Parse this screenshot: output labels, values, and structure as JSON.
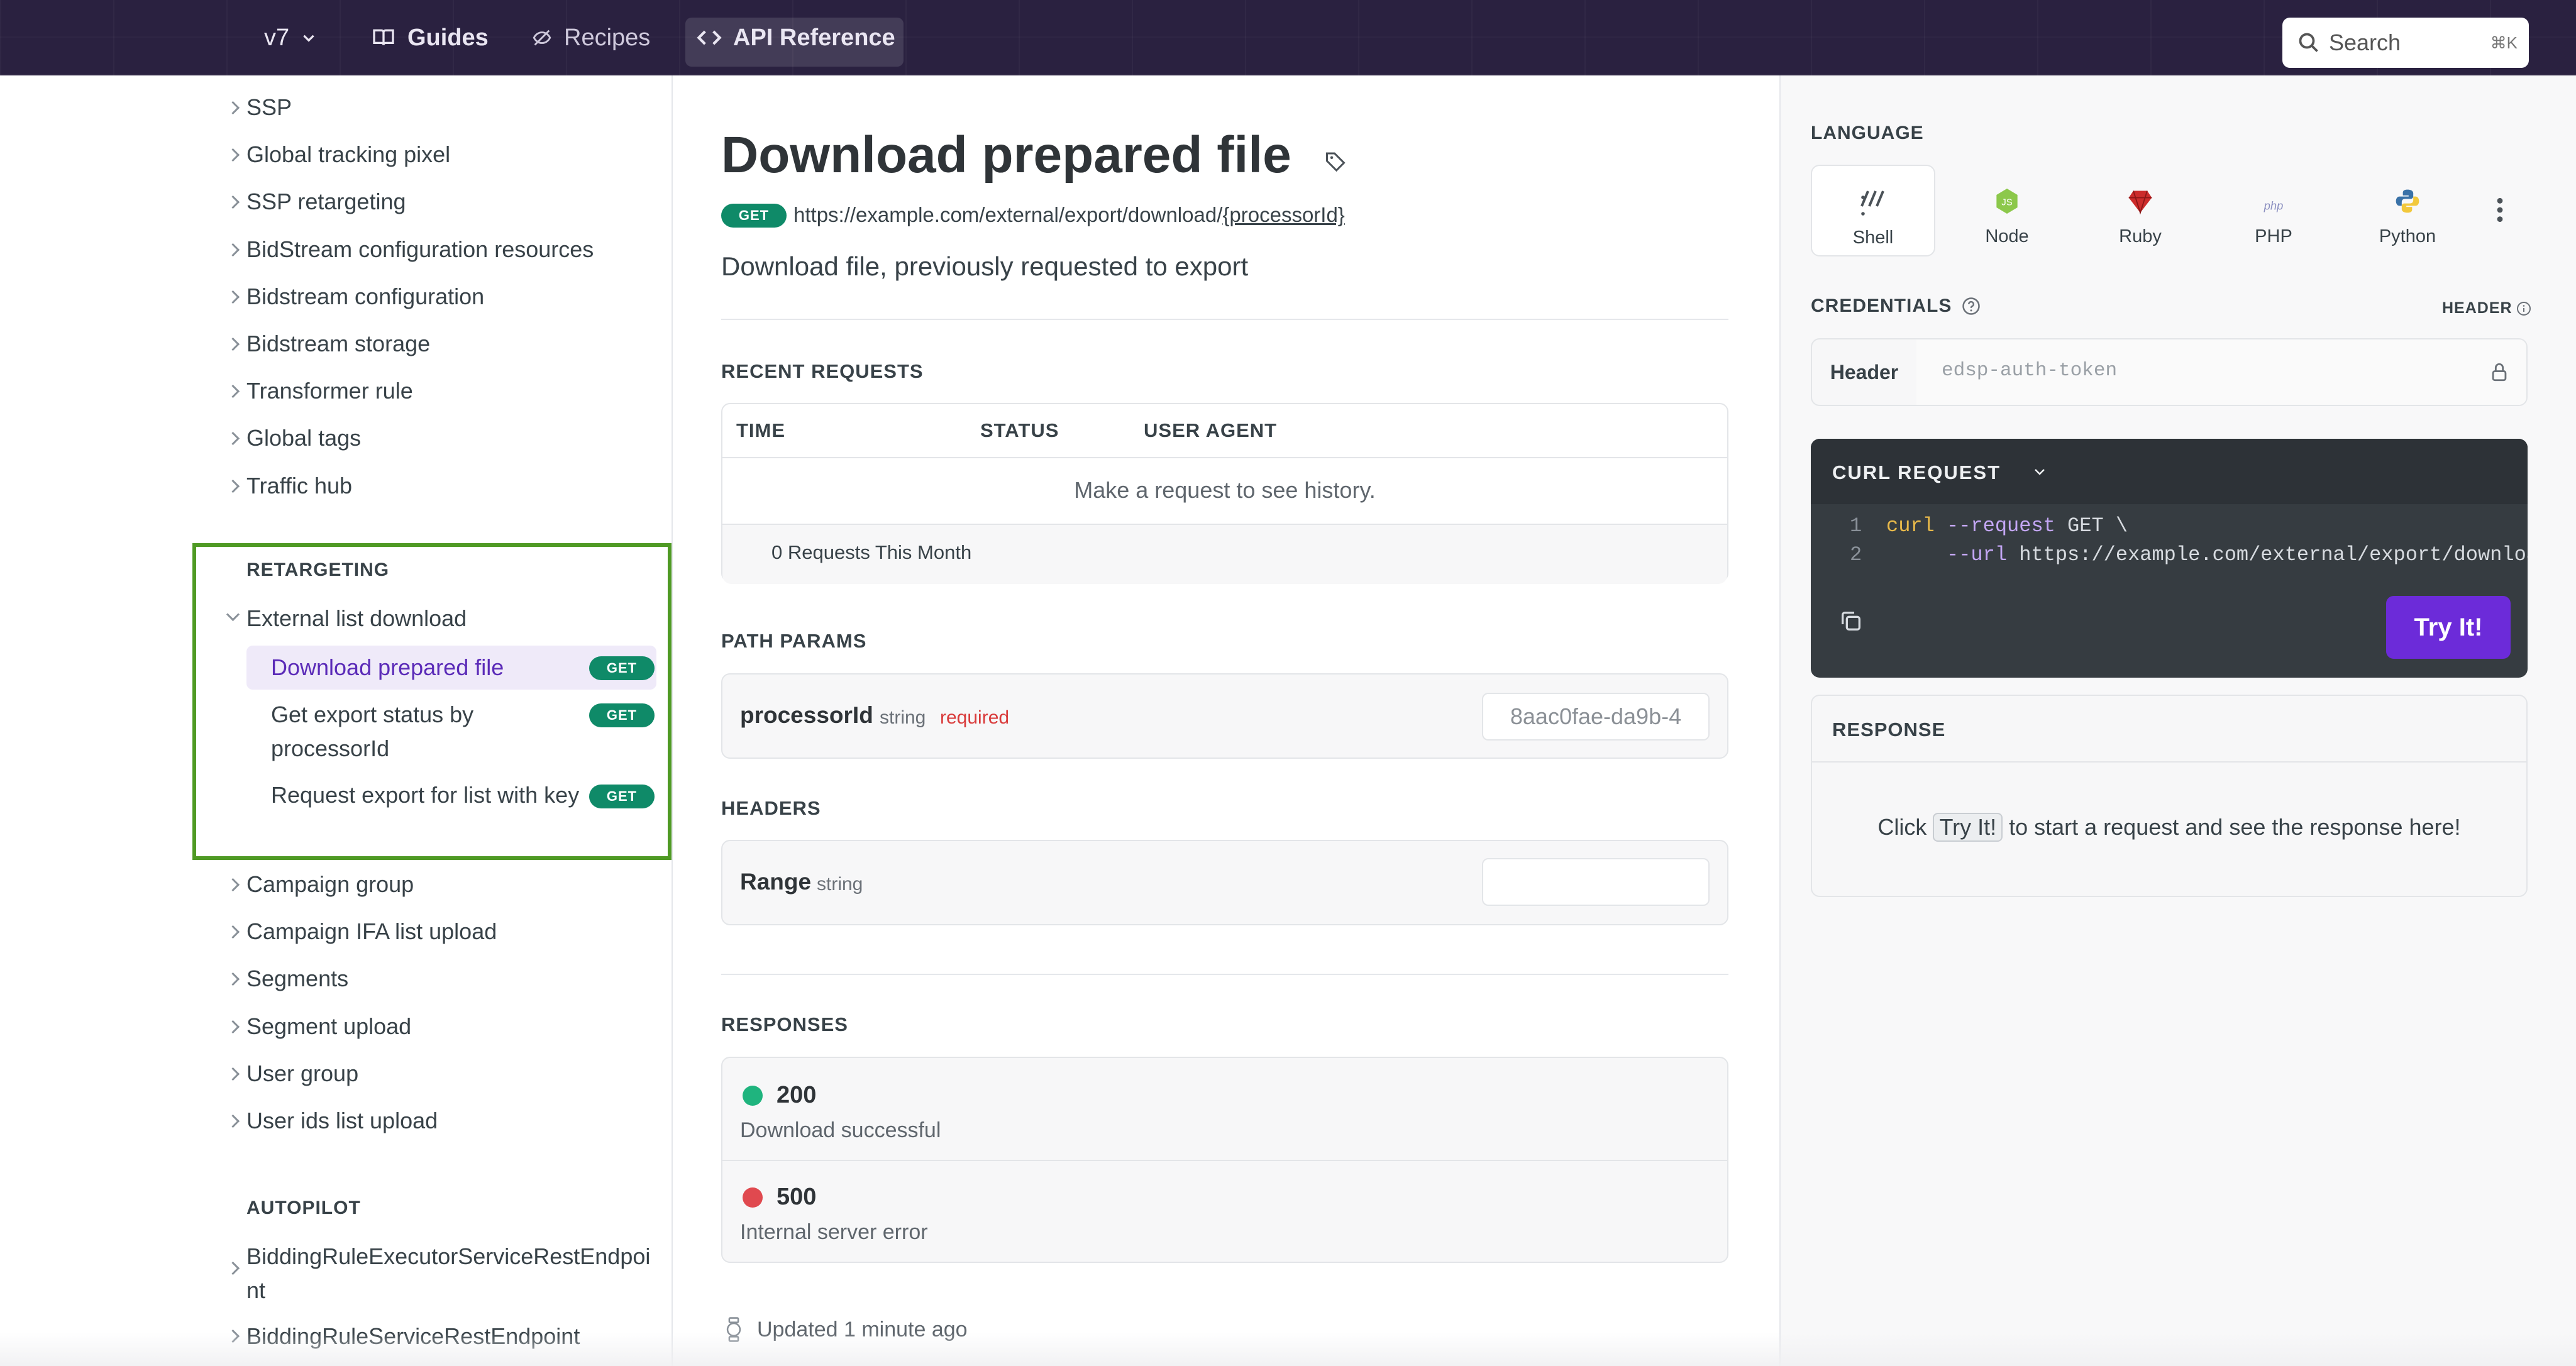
{
  "nav": {
    "version": "v7",
    "guides": "Guides",
    "recipes": "Recipes",
    "api_reference": "API Reference",
    "search_placeholder": "Search",
    "search_shortcut": "⌘K"
  },
  "sidebar": {
    "items_top": [
      "SSP",
      "Global tracking pixel",
      "SSP retargeting",
      "BidStream configuration resources",
      "Bidstream configuration",
      "Bidstream storage",
      "Transformer rule",
      "Global tags",
      "Traffic hub"
    ],
    "retargeting_title": "RETARGETING",
    "group_label": "External list download",
    "sub_items": [
      {
        "label": "Download prepared file",
        "method": "GET"
      },
      {
        "label": "Get export status by processorId",
        "method": "GET"
      },
      {
        "label": "Request export for list with key",
        "method": "GET"
      }
    ],
    "items_after": [
      "Campaign group",
      "Campaign IFA list upload",
      "Segments",
      "Segment upload",
      "User group",
      "User ids list upload"
    ],
    "autopilot_title": "AUTOPILOT",
    "autopilot_items": [
      "BiddingRuleExecutorServiceRestEndpoint",
      "BiddingRuleServiceRestEndpoint"
    ]
  },
  "main": {
    "title": "Download prepared file",
    "method": "GET",
    "url_prefix": "https://example.com/external/export/download/",
    "url_param": "{processorId}",
    "description": "Download file, previously requested to export",
    "recent_requests": {
      "title": "RECENT REQUESTS",
      "columns": [
        "TIME",
        "STATUS",
        "USER AGENT"
      ],
      "empty": "Make a request to see history.",
      "count": "0 Requests This Month"
    },
    "path_params": {
      "title": "PATH PARAMS",
      "name": "processorId",
      "type": "string",
      "required": "required",
      "value": "8aac0fae-da9b-4"
    },
    "headers": {
      "title": "HEADERS",
      "name": "Range",
      "type": "string"
    },
    "responses": {
      "title": "RESPONSES",
      "items": [
        {
          "code": "200",
          "desc": "Download successful",
          "color": "#1fb47e"
        },
        {
          "code": "500",
          "desc": "Internal server error",
          "color": "#e0494f"
        }
      ]
    },
    "updated": "Updated 1 minute ago"
  },
  "right": {
    "language_title": "LANGUAGE",
    "languages": [
      "Shell",
      "Node",
      "Ruby",
      "PHP",
      "Python"
    ],
    "credentials_title": "CREDENTIALS",
    "header_toggle": "HEADER",
    "header_label": "Header",
    "token_placeholder": "edsp-auth-token",
    "curl_title": "CURL REQUEST",
    "code_lines": [
      {
        "n": "1",
        "text": "curl --request GET \\"
      },
      {
        "n": "2",
        "text": "     --url https://example.com/external/export/downloa"
      }
    ],
    "try_it": "Try It!",
    "response_title": "RESPONSE",
    "response_pre": "Click",
    "response_chip": "Try It!",
    "response_post": "to start a request and see the response here!"
  },
  "colors": {
    "topbar": "#2a2140",
    "accent_purple": "#6c2bd9",
    "get_badge": "#0f8a68",
    "highlight_border": "#4f9a24"
  }
}
